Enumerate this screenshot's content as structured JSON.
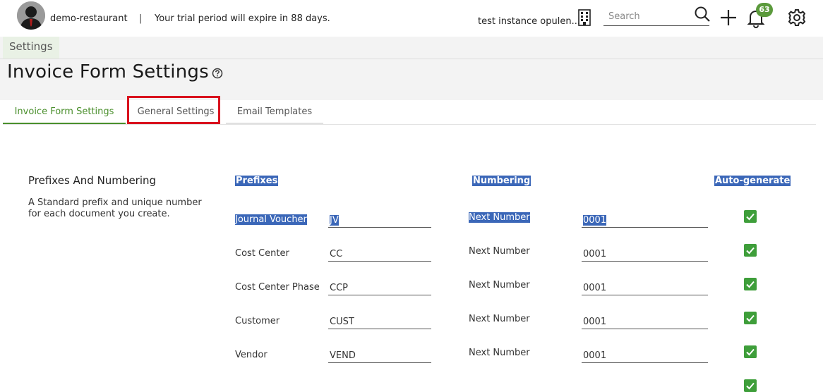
{
  "header": {
    "org_name": "demo-restaurant",
    "separator": "|",
    "trial_text": "Your trial period will expire in 88 days.",
    "instance_name": "test instance opulen...",
    "search_placeholder": "Search",
    "notification_count": "63"
  },
  "breadcrumb": {
    "label": "Settings"
  },
  "page": {
    "title": "Invoice Form Settings"
  },
  "tabs": [
    {
      "label": "Invoice Form Settings",
      "active": true
    },
    {
      "label": "General Settings",
      "active": false
    },
    {
      "label": "Email Templates",
      "active": false
    }
  ],
  "section": {
    "title": "Prefixes And Numbering",
    "description": "A Standard prefix and unique number for each document you create."
  },
  "columns": {
    "prefixes": "Prefixes",
    "numbering": "Numbering",
    "auto_generate": "Auto-generate"
  },
  "rows": [
    {
      "label": "Journal Voucher",
      "prefix": "JV",
      "number_label": "Next Number",
      "number": "0001",
      "auto": true
    },
    {
      "label": "Cost Center",
      "prefix": "CC",
      "number_label": "Next Number",
      "number": "0001",
      "auto": true
    },
    {
      "label": "Cost Center Phase",
      "prefix": "CCP",
      "number_label": "Next Number",
      "number": "0001",
      "auto": true
    },
    {
      "label": "Customer",
      "prefix": "CUST",
      "number_label": "Next Number",
      "number": "0001",
      "auto": true
    },
    {
      "label": "Vendor",
      "prefix": "VEND",
      "number_label": "Next Number",
      "number": "0001",
      "auto": true
    }
  ],
  "colors": {
    "accent": "#4a8f2c",
    "selection": "#3b67b8",
    "check": "#3e9e3a",
    "highlight": "#d9121e"
  }
}
